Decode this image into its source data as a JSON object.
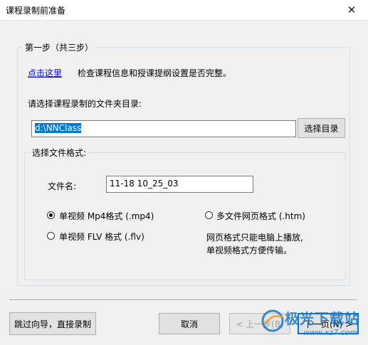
{
  "window": {
    "title": "课程录制前准备",
    "close_glyph": "✕"
  },
  "step_group": {
    "legend": "第一步（共三步）",
    "link_label": "点击这里",
    "link_description": "检查课程信息和授课提纲设置是否完整。",
    "folder_prompt": "请选择课程录制的文件夹目录:",
    "folder_value": "d:\\NNClass",
    "browse_button": "选择目录"
  },
  "format_group": {
    "legend": "选择文件格式:",
    "filename_label": "文件名:",
    "filename_value": "11-18 10_25_03",
    "options": [
      {
        "label": "单视频 Mp4格式 (.mp4)",
        "checked": true
      },
      {
        "label": "多文件网页格式 (.htm)",
        "checked": false
      },
      {
        "label": "单视频 FLV 格式 (.flv)",
        "checked": false
      }
    ],
    "note_line1": "网页格式只能电脑上播放,",
    "note_line2": "单视频格式方便传输。"
  },
  "footer": {
    "skip_button": "跳过向导，直接录制",
    "cancel_button": "取消",
    "prev_button": "< 上一步(B)",
    "next_button": "下一页(N) >"
  },
  "watermark": {
    "text": "极光下载站",
    "url": "www.xz7.com",
    "accent_color": "#1a78c8"
  }
}
